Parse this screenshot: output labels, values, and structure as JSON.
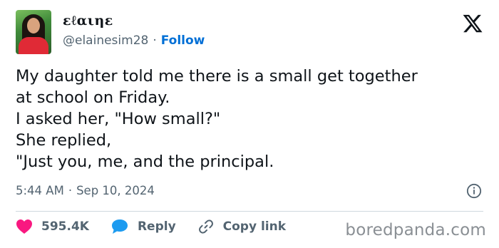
{
  "author": {
    "display_name": "ɛℓαιηɛ",
    "handle": "@elainesim28",
    "separator": "·",
    "follow_label": "Follow"
  },
  "tweet": {
    "lines": [
      "My daughter told me there is a small get together",
      "at school on Friday.",
      "I asked her, \"How small?\"",
      "She replied,",
      "\"Just you, me, and the principal."
    ],
    "time": "5:44 AM",
    "separator": "·",
    "date": "Sep 10, 2024"
  },
  "actions": {
    "like_count": "595.4K",
    "reply_label": "Reply",
    "copy_link_label": "Copy link"
  },
  "watermark": "boredpanda.com",
  "icons": {
    "logo": "x-logo-icon",
    "info": "info-icon",
    "like": "heart-icon",
    "reply": "speech-bubble-icon",
    "copy": "link-icon"
  },
  "colors": {
    "like": "#f91880",
    "reply": "#1d9bf0",
    "follow": "#006fd6",
    "muted": "#536471"
  }
}
